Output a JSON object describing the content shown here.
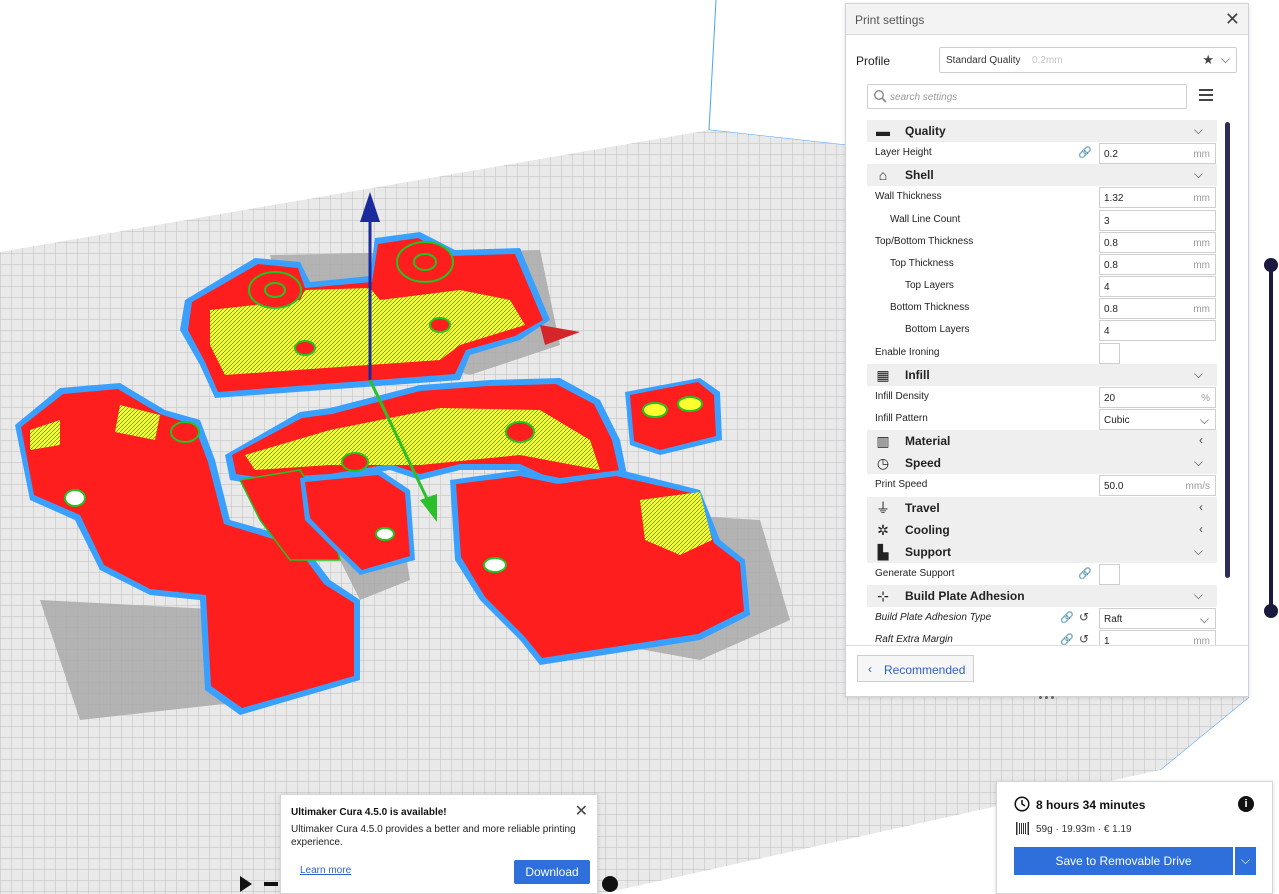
{
  "settings_panel": {
    "title": "Print settings",
    "close_icon": "close-icon",
    "profile": {
      "label": "Profile",
      "name": "Standard Quality",
      "layer": "0.2mm"
    },
    "search": {
      "placeholder": "search settings",
      "value": ""
    },
    "rows": [
      {
        "kind": "category",
        "label": "Quality",
        "icon": "quality-icon",
        "chevron": "down"
      },
      {
        "kind": "input",
        "label": "Layer Height",
        "value": "0.2",
        "unit": "mm",
        "indent": 0,
        "link": true
      },
      {
        "kind": "category",
        "label": "Shell",
        "icon": "shell-icon",
        "chevron": "down"
      },
      {
        "kind": "input",
        "label": "Wall Thickness",
        "value": "1.32",
        "unit": "mm",
        "indent": 0
      },
      {
        "kind": "input",
        "label": "Wall Line Count",
        "value": "3",
        "unit": "",
        "indent": 1
      },
      {
        "kind": "input",
        "label": "Top/Bottom Thickness",
        "value": "0.8",
        "unit": "mm",
        "indent": 0
      },
      {
        "kind": "input",
        "label": "Top Thickness",
        "value": "0.8",
        "unit": "mm",
        "indent": 1
      },
      {
        "kind": "input",
        "label": "Top Layers",
        "value": "4",
        "unit": "",
        "indent": 2
      },
      {
        "kind": "input",
        "label": "Bottom Thickness",
        "value": "0.8",
        "unit": "mm",
        "indent": 1
      },
      {
        "kind": "input",
        "label": "Bottom Layers",
        "value": "4",
        "unit": "",
        "indent": 2
      },
      {
        "kind": "checkbox",
        "label": "Enable Ironing",
        "checked": false,
        "indent": 0
      },
      {
        "kind": "category",
        "label": "Infill",
        "icon": "infill-icon",
        "chevron": "down"
      },
      {
        "kind": "input",
        "label": "Infill Density",
        "value": "20",
        "unit": "%",
        "indent": 0
      },
      {
        "kind": "select",
        "label": "Infill Pattern",
        "value": "Cubic",
        "indent": 0
      },
      {
        "kind": "category",
        "label": "Material",
        "icon": "material-icon",
        "chevron": "left"
      },
      {
        "kind": "category",
        "label": "Speed",
        "icon": "speed-icon",
        "chevron": "down"
      },
      {
        "kind": "input",
        "label": "Print Speed",
        "value": "50.0",
        "unit": "mm/s",
        "indent": 0
      },
      {
        "kind": "category",
        "label": "Travel",
        "icon": "travel-icon",
        "chevron": "left"
      },
      {
        "kind": "category",
        "label": "Cooling",
        "icon": "cooling-icon",
        "chevron": "left"
      },
      {
        "kind": "category",
        "label": "Support",
        "icon": "support-icon",
        "chevron": "down"
      },
      {
        "kind": "checkbox",
        "label": "Generate Support",
        "checked": false,
        "indent": 0,
        "link": true
      },
      {
        "kind": "category",
        "label": "Build Plate Adhesion",
        "icon": "adhesion-icon",
        "chevron": "down"
      },
      {
        "kind": "select",
        "label": "Build Plate Adhesion Type",
        "value": "Raft",
        "indent": 0,
        "italic": true,
        "link": true,
        "reset": true
      },
      {
        "kind": "input",
        "label": "Raft Extra Margin",
        "value": "1",
        "unit": "mm",
        "indent": 0,
        "italic": true,
        "link": true,
        "reset": true
      }
    ],
    "recommended_label": "Recommended"
  },
  "update_notification": {
    "title": "Ultimaker Cura 4.5.0 is available!",
    "body": "Ultimaker Cura 4.5.0 provides a better and more reliable printing experience.",
    "learn_more": "Learn more",
    "download": "Download"
  },
  "print_estimate": {
    "time": "8 hours 34 minutes",
    "material": "59g · 19.93m · € 1.19",
    "save_label": "Save to Removable Drive",
    "info_icon": "info-icon"
  },
  "colors": {
    "accent": "#2e6fdb",
    "model_red": "#ff1e1e",
    "model_yellow": "#ffff2e",
    "model_green": "#22c422",
    "model_blue": "#3aa0ff",
    "plate": "#e8e8e8",
    "slider": "#1b1a3e"
  }
}
